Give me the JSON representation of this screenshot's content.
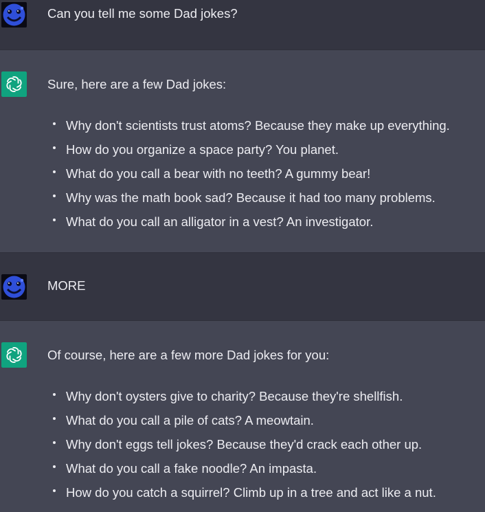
{
  "thread": {
    "messages": [
      {
        "role": "user",
        "avatar_icon": "blue-face-avatar",
        "text": "Can you tell me some Dad jokes?"
      },
      {
        "role": "assistant",
        "avatar_icon": "openai-logo",
        "intro": "Sure, here are a few Dad jokes:",
        "jokes": [
          "Why don't scientists trust atoms? Because they make up everything.",
          "How do you organize a space party? You planet.",
          "What do you call a bear with no teeth? A gummy bear!",
          "Why was the math book sad? Because it had too many problems.",
          "What do you call an alligator in a vest? An investigator."
        ]
      },
      {
        "role": "user",
        "avatar_icon": "blue-face-avatar",
        "text": "MORE"
      },
      {
        "role": "assistant",
        "avatar_icon": "openai-logo",
        "intro": "Of course, here are a few more Dad jokes for you:",
        "jokes": [
          "Why don't oysters give to charity? Because they're shellfish.",
          "What do you call a pile of cats? A meowtain.",
          "Why don't eggs tell jokes? Because they'd crack each other up.",
          "What do you call a fake noodle? An impasta.",
          "How do you catch a squirrel? Climb up in a tree and act like a nut."
        ]
      }
    ]
  },
  "colors": {
    "user_bg": "#343541",
    "assistant_bg": "#444654",
    "text": "#ECECF1",
    "assistant_avatar": "#10A37F"
  }
}
